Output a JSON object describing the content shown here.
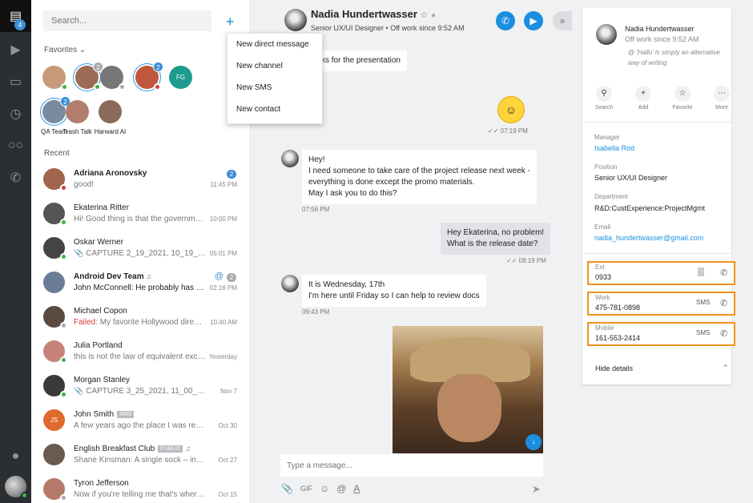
{
  "rail": {
    "badge": "4"
  },
  "panel": {
    "search_placeholder": "Search...",
    "favorites_label": "Favorites",
    "recent_label": "Recent",
    "favorites": [
      {
        "name": "",
        "initials": "",
        "color": "#c89a7a",
        "status": "online"
      },
      {
        "name": "",
        "initials": "",
        "color": "#9d6b55",
        "status": "online",
        "count": "2"
      },
      {
        "name": "",
        "initials": "",
        "color": "#777777",
        "status": "offline"
      },
      {
        "name": "",
        "initials": "",
        "color": "#c0563b",
        "status": "busy",
        "count": "2"
      },
      {
        "name": "",
        "initials": "FG",
        "color": "#1e9a8f",
        "status": ""
      },
      {
        "name": "QA Team",
        "initials": "",
        "color": "#7a8aa0",
        "status": "",
        "count": "2"
      },
      {
        "name": "Trash Talk",
        "initials": "",
        "color": "#b27d6d",
        "status": ""
      },
      {
        "name": "Harward AI",
        "initials": "",
        "color": "#8a6a5a",
        "status": ""
      }
    ],
    "conversations": [
      {
        "name": "Adriana Aronovsky",
        "preview": "good!",
        "time": "11:45 PM",
        "badge": "2",
        "bold": true,
        "color": "#a0654c",
        "status": "busy"
      },
      {
        "name": "Ekaterina Ritter",
        "preview": "Hi! Good thing is that the government...",
        "time": "10:00 PM",
        "color": "#555555",
        "status": "online"
      },
      {
        "name": "Oskar Werner",
        "preview": "📎 CAPTURE 2_19_2021, 10_19_26.png",
        "time": "05:01 PM",
        "color": "#444444",
        "status": "online"
      },
      {
        "name": "Android Dev Team",
        "preview": "John McConnell: He probably has the ...",
        "time": "02:16 PM",
        "badge": "2",
        "gray_badge": true,
        "at": "@",
        "bold": true,
        "dark": true,
        "color": "#6b7d95",
        "status": ""
      },
      {
        "name": "Michael Copon",
        "failed": "Failed:",
        "preview": "My favorite Hollywood director...",
        "time": "10:40 AM",
        "color": "#5a4a40",
        "status": "offline"
      },
      {
        "name": "Julia Portland",
        "preview": "this is not the law of equivalent excha...",
        "time": "Yesterday",
        "color": "#c6827a",
        "status": "online"
      },
      {
        "name": "Morgan Stanley",
        "preview": "📎 CAPTURE 3_25_2021, 11_00_21.png",
        "time": "Nov 7",
        "color": "#3a3a3a",
        "status": "online"
      },
      {
        "name": "John Smith",
        "tag": "SMS",
        "preview": "A few years ago the place I was rentin...",
        "time": "Oct 30",
        "color": "#e06a2c",
        "initials": "JS",
        "status": ""
      },
      {
        "name": "English Breakfast Club",
        "tag": "PUBLIC",
        "preview": "Shane Kinsman: A single sock – inside ...",
        "time": "Oct 27",
        "color": "#6b5a50",
        "status": ""
      },
      {
        "name": "Tyron Jefferson",
        "preview": "Now if you're telling me that's where a...",
        "time": "Oct 15",
        "color": "#b5796a",
        "status": "offline"
      }
    ]
  },
  "menu": {
    "items": [
      "New direct message",
      "New channel",
      "New SMS",
      "New contact"
    ]
  },
  "chat": {
    "name": "Nadia Hundertwasser",
    "subtitle": "Senior UX/UI Designer  •  Off work since 9:52 AM",
    "msg1": "ks for the presentation",
    "emoji_time": "07:19 PM",
    "msg2_lines": [
      "Hey!",
      "I need someone to take care of the project release next week -",
      "everything is done except the promo materials.",
      "May I ask you to do this?"
    ],
    "msg2_time": "07:56 PM",
    "msg3_lines": [
      "Hey Ekaterina, no problem!",
      "What is the release date?"
    ],
    "msg3_time": "08:19 PM",
    "msg4_lines": [
      "It is Wednesday, 17th",
      "I'm here until Friday so I can help to review docs"
    ],
    "msg4_time": "09:43 PM",
    "composer_placeholder": "Type a message...",
    "gif_label": "GIF"
  },
  "details": {
    "name": "Nadia Hundertwasser",
    "sub": "Off work since 9:52 AM",
    "note": "@ 'Hallo' is simply an alternative way of writing",
    "actions": [
      "Search",
      "Add",
      "Favorite",
      "More"
    ],
    "manager_label": "Manager",
    "manager": "Isabella Rod",
    "position_label": "Position",
    "position": "Senior UX/UI Designer",
    "department_label": "Department",
    "department": "R&D:CustExperience:ProjectMgmt",
    "email_label": "Email",
    "email": "nadia_hundertwasser@gmail.com",
    "ext_label": "Ext",
    "ext": "0933",
    "work_label": "Work",
    "work": "475-781-0898",
    "mobile_label": "Mobile",
    "mobile": "161-553-2414",
    "sms_label": "SMS",
    "hide_label": "Hide details"
  }
}
